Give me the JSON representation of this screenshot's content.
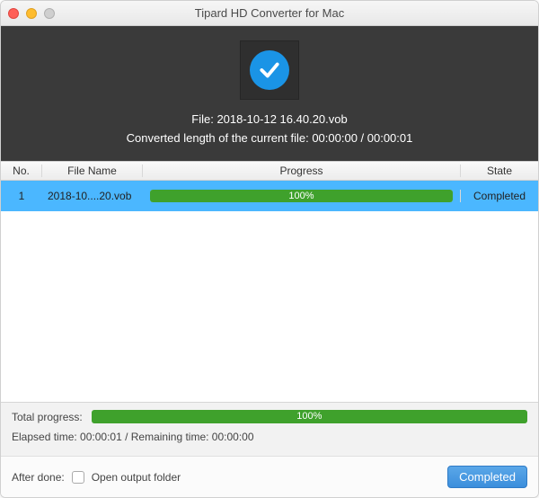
{
  "window": {
    "title": "Tipard HD Converter for Mac"
  },
  "header": {
    "file_label_prefix": "File: ",
    "file_name": "2018-10-12 16.40.20.vob",
    "converted_line": "Converted length of the current file: 00:00:00 / 00:00:01"
  },
  "columns": {
    "no": "No.",
    "name": "File Name",
    "progress": "Progress",
    "state": "State"
  },
  "rows": [
    {
      "no": "1",
      "name": "2018-10....20.vob",
      "progress_pct": "100%",
      "state": "Completed"
    }
  ],
  "footer": {
    "total_label": "Total progress:",
    "total_pct": "100%",
    "times": "Elapsed time: 00:00:01 / Remaining time: 00:00:00"
  },
  "bottom": {
    "after_done_label": "After done:",
    "open_output_label": "Open output folder",
    "completed_button": "Completed"
  }
}
